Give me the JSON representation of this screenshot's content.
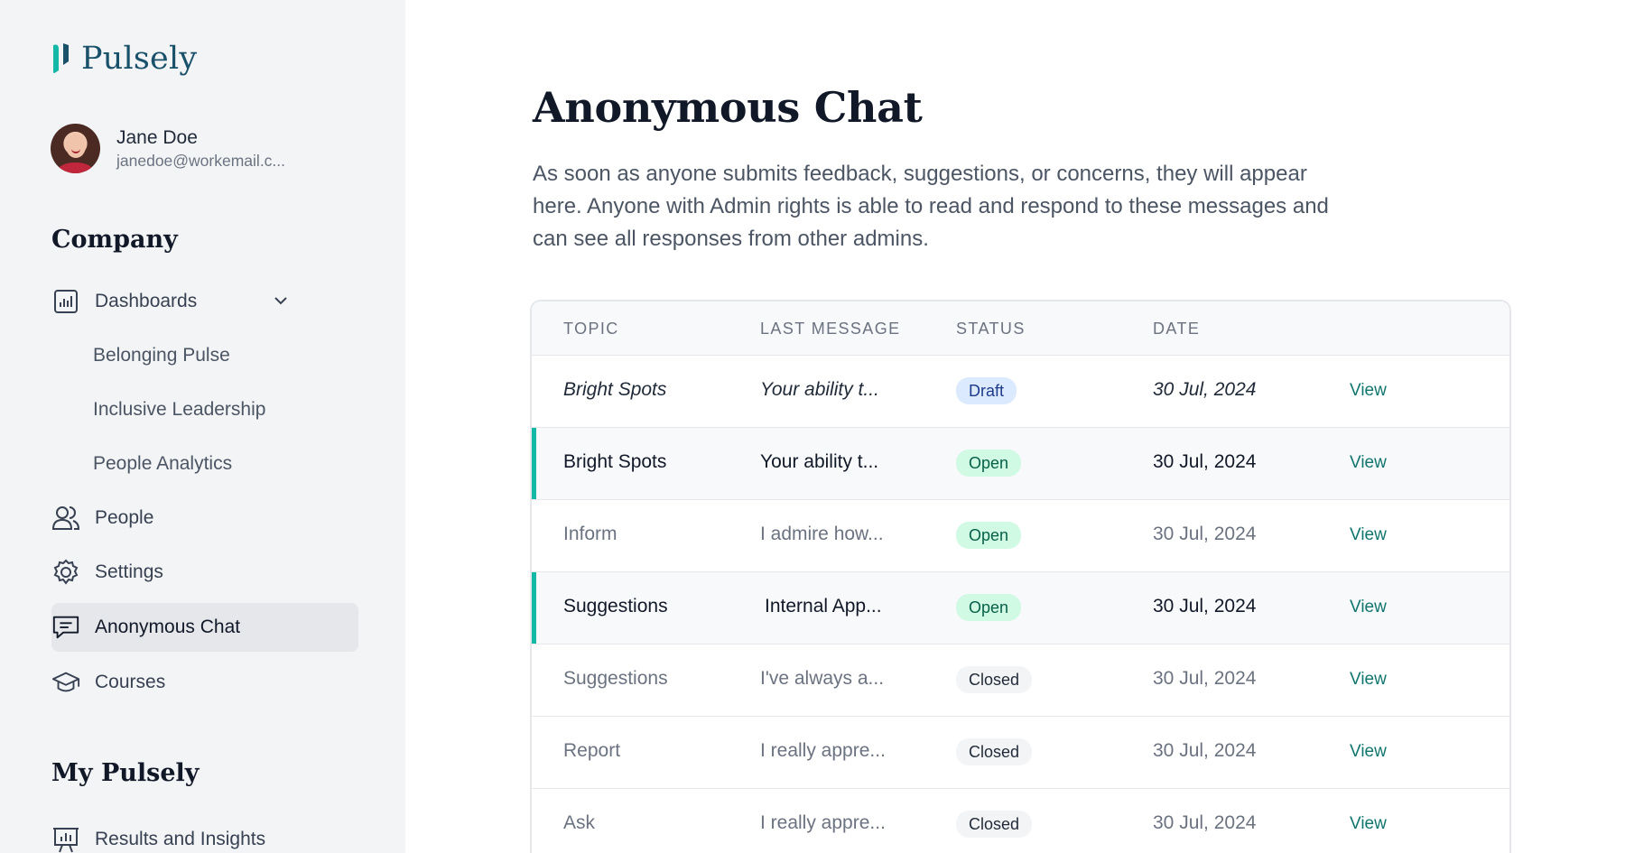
{
  "brand": {
    "name": "Pulsely",
    "accent": "#14b8a6",
    "logo_color": "#19506a"
  },
  "user": {
    "name": "Jane Doe",
    "email": "janedoe@workemail.c..."
  },
  "sidebar": {
    "company_title": "Company",
    "my_title": "My Pulsely",
    "items": {
      "dashboards": {
        "label": "Dashboards",
        "icon": "bar-chart-icon"
      },
      "belonging": {
        "label": "Belonging Pulse"
      },
      "inclusive": {
        "label": "Inclusive Leadership"
      },
      "analytics": {
        "label": "People Analytics"
      },
      "people": {
        "label": "People",
        "icon": "users-icon"
      },
      "settings": {
        "label": "Settings",
        "icon": "gear-icon"
      },
      "chat": {
        "label": "Anonymous Chat",
        "icon": "chat-icon",
        "active": true
      },
      "courses": {
        "label": "Courses",
        "icon": "graduation-cap-icon"
      },
      "results": {
        "label": "Results and Insights",
        "icon": "presentation-chart-icon"
      }
    }
  },
  "main": {
    "title": "Anonymous Chat",
    "description": "As soon as anyone submits feedback, suggestions, or concerns, they will appear here. Anyone with Admin rights is able to read and respond to these messages and can see all responses from other admins.",
    "table": {
      "headers": {
        "topic": "TOPIC",
        "last_message": "LAST MESSAGE",
        "status": "STATUS",
        "date": "DATE"
      },
      "rows": [
        {
          "topic": "Bright Spots",
          "message": "Your ability t...",
          "status": "Draft",
          "date": "30 Jul, 2024",
          "action": "View"
        },
        {
          "topic": "Bright Spots",
          "message": "Your ability t...",
          "status": "Open",
          "date": "30 Jul, 2024",
          "action": "View"
        },
        {
          "topic": "Inform",
          "message": "I admire how...",
          "status": "Open",
          "date": "30 Jul, 2024",
          "action": "View"
        },
        {
          "topic": "Suggestions",
          "message": "Internal App...",
          "status": "Open",
          "date": "30 Jul, 2024",
          "action": "View"
        },
        {
          "topic": "Suggestions",
          "message": "I've always a...",
          "status": "Closed",
          "date": "30 Jul, 2024",
          "action": "View"
        },
        {
          "topic": "Report",
          "message": "I really appre...",
          "status": "Closed",
          "date": "30 Jul, 2024",
          "action": "View"
        },
        {
          "topic": "Ask",
          "message": "I really appre...",
          "status": "Closed",
          "date": "30 Jul, 2024",
          "action": "View"
        }
      ]
    }
  }
}
